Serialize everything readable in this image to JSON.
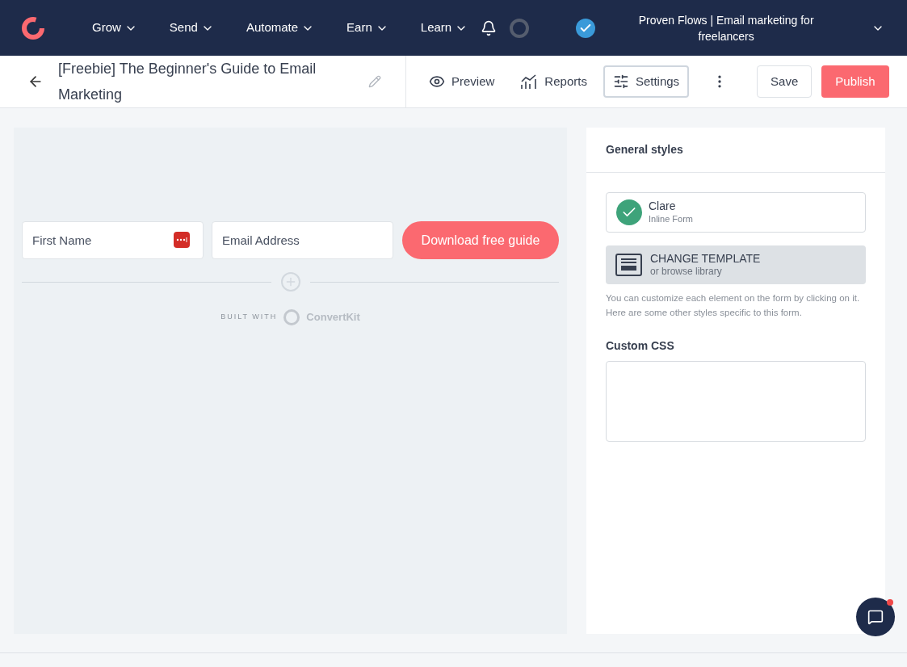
{
  "nav": {
    "items": [
      {
        "label": "Grow"
      },
      {
        "label": "Send"
      },
      {
        "label": "Automate"
      },
      {
        "label": "Earn"
      },
      {
        "label": "Learn"
      }
    ],
    "account": "Proven Flows | Email marketing for freelancers"
  },
  "toolbar": {
    "title": "[Freebie] The Beginner's Guide to Email Marketing",
    "actions": [
      {
        "label": "Preview",
        "kind": "preview",
        "selected": false
      },
      {
        "label": "Reports",
        "kind": "reports",
        "selected": false
      },
      {
        "label": "Settings",
        "kind": "settings",
        "selected": true
      }
    ],
    "save": "Save",
    "publish": "Publish"
  },
  "form": {
    "fields": [
      {
        "placeholder": "First Name",
        "password_manager": true
      },
      {
        "placeholder": "Email Address",
        "password_manager": false
      }
    ],
    "submit": "Download free guide",
    "built_with": "BUILT WITH",
    "brand": "ConvertKit"
  },
  "panel": {
    "heading": "General styles",
    "template": {
      "name": "Clare",
      "type": "Inline Form"
    },
    "change": {
      "title": "CHANGE TEMPLATE",
      "subtitle": "or browse library"
    },
    "help": "You can customize each element on the form by clicking on it. Here are some other styles specific to this form.",
    "css_label": "Custom CSS"
  },
  "chat": {
    "unread": true
  }
}
